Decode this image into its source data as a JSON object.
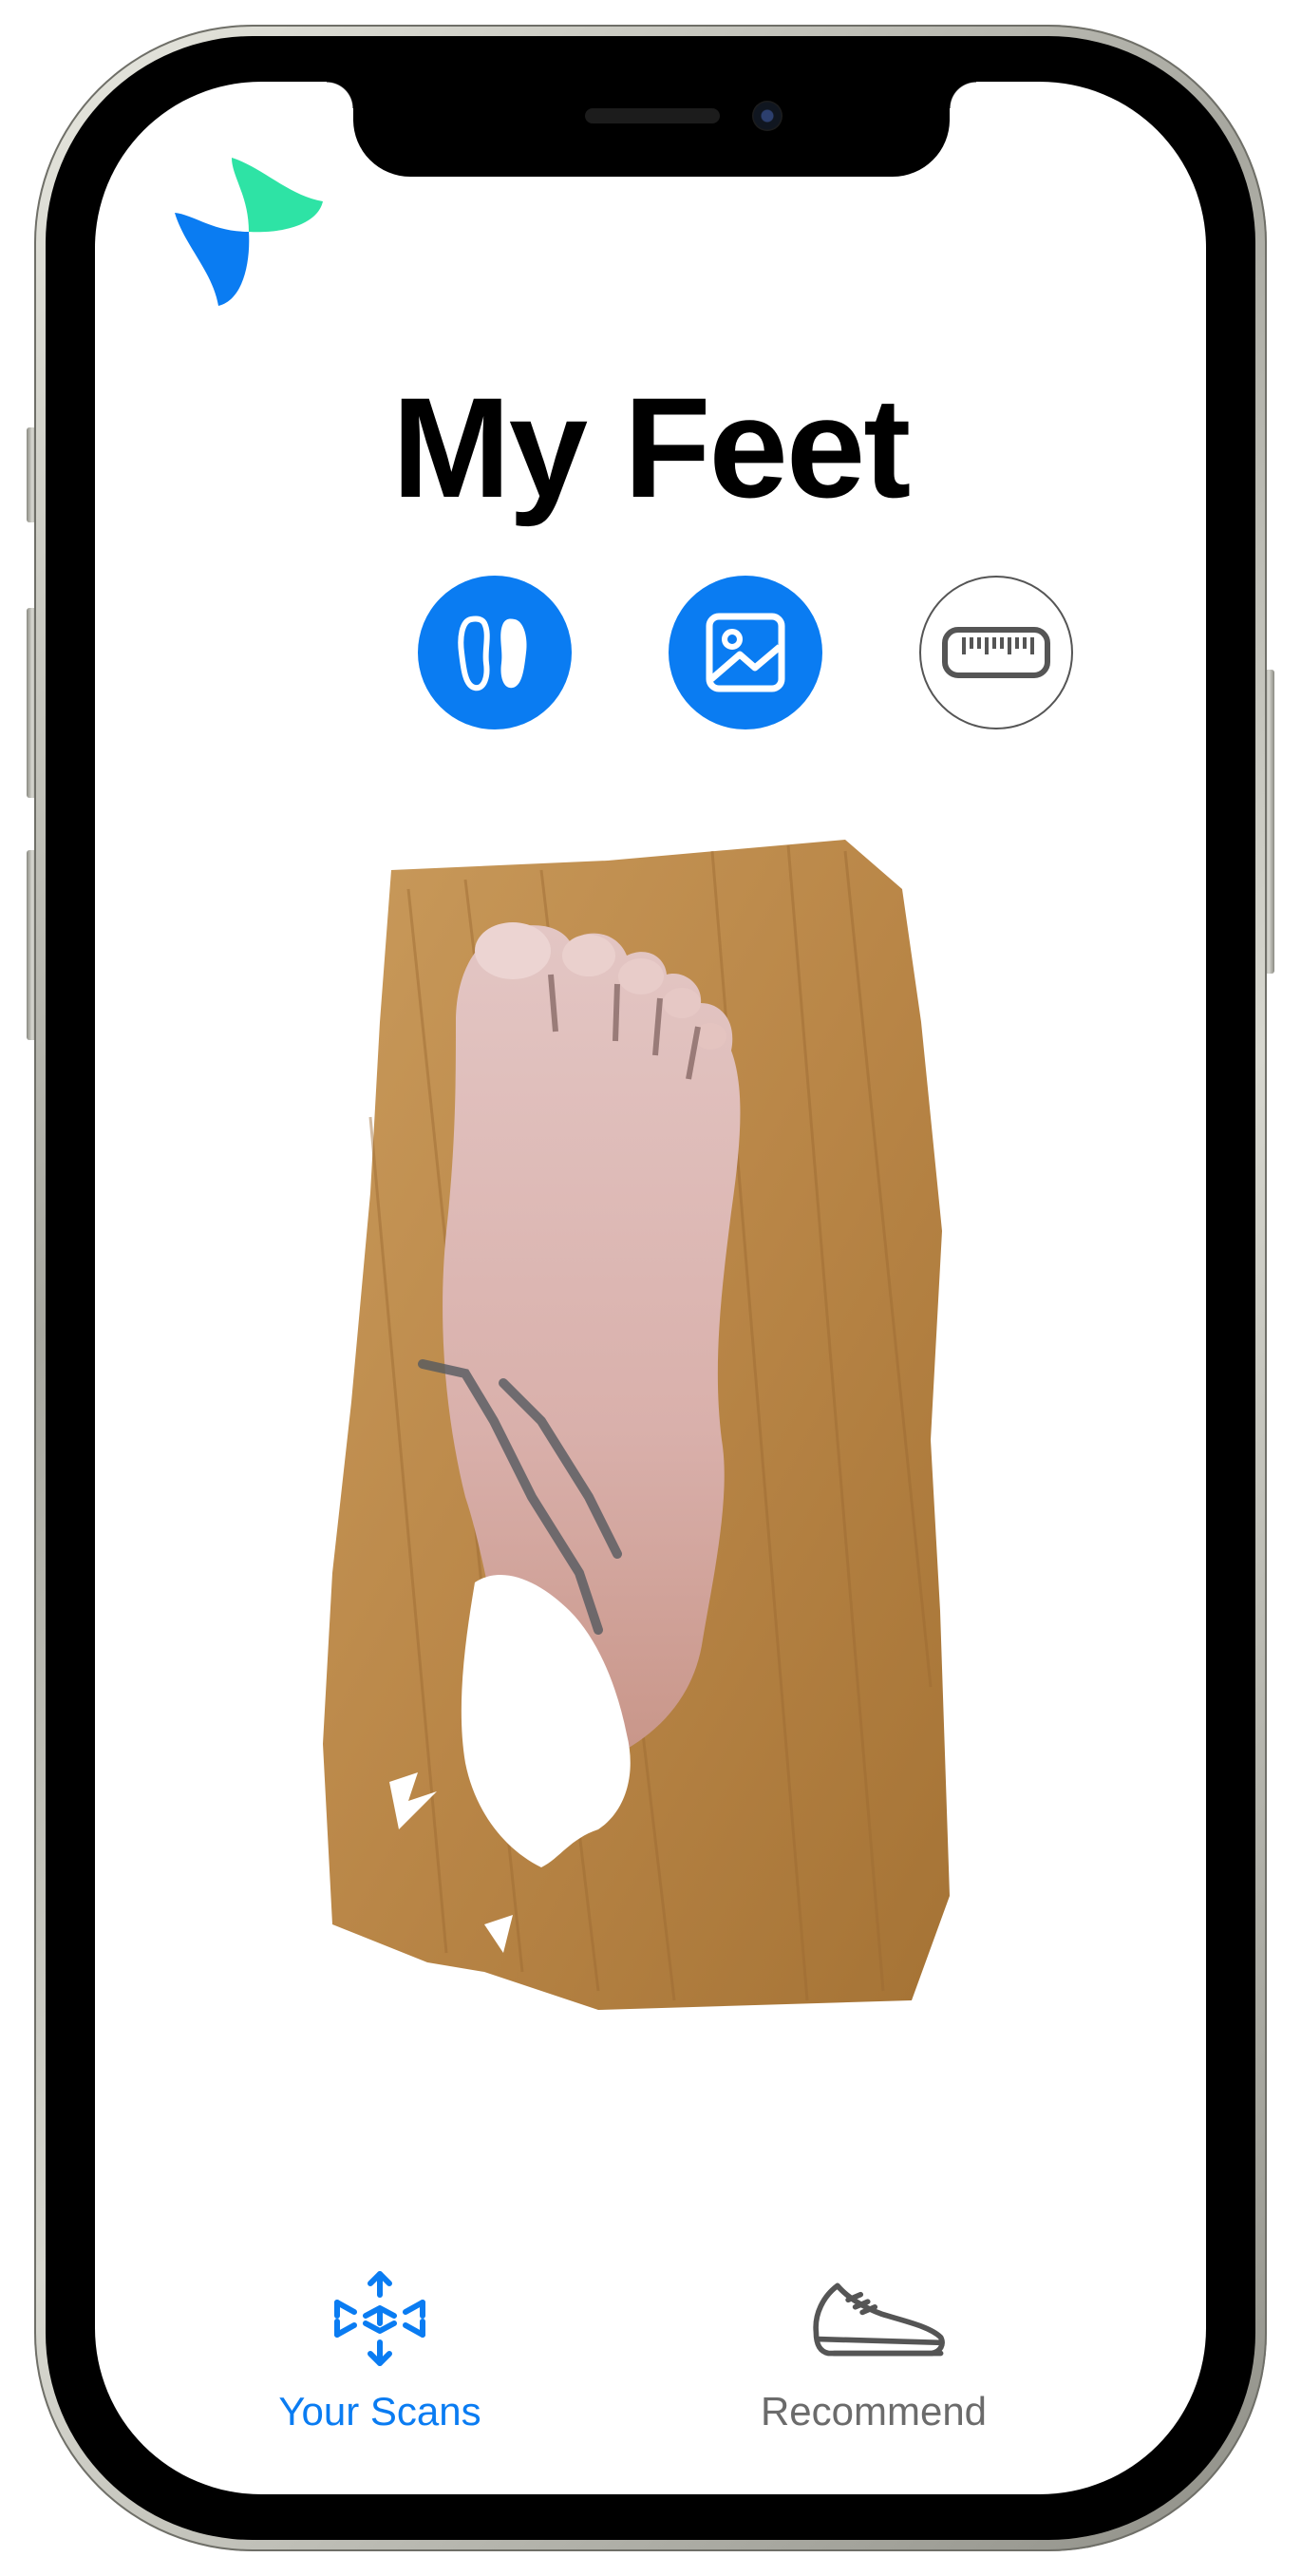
{
  "screen": {
    "title": "My Feet"
  },
  "actions": [
    {
      "icon": "feet-icon",
      "active": true
    },
    {
      "icon": "photo-icon",
      "active": true
    },
    {
      "icon": "ruler-icon",
      "active": false
    }
  ],
  "scan": {
    "content": "3D foot scan on wooden surface"
  },
  "tabbar": {
    "tabs": [
      {
        "label": "Your Scans",
        "icon": "scan-cube-icon",
        "selected": true
      },
      {
        "label": "Recommend",
        "icon": "sneaker-icon",
        "selected": false
      }
    ]
  },
  "colors": {
    "accent": "#0a7cf2",
    "logo_green": "#2ee3a5",
    "logo_blue": "#0a7cf2",
    "inactive": "#6b6b6b"
  }
}
